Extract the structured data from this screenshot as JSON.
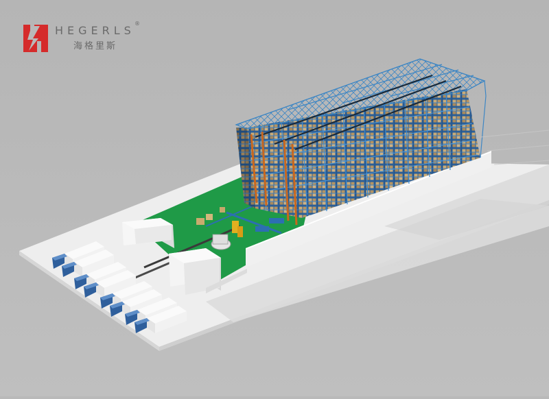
{
  "brand": {
    "name_en": "HEGERLS",
    "registered_mark": "®",
    "name_cn": "海格里斯",
    "logo": "hegerls-logo-mark"
  },
  "colors": {
    "background": "#b9b9b9",
    "ground": "#f3f3f3",
    "floor": "#22a34a",
    "rack_blue": "#2f6fb0",
    "crane_orange": "#c8671f",
    "logo_red": "#d52b2b"
  },
  "scene": {
    "subject": "warehouse-3d-rendering",
    "truck_count": 10
  }
}
